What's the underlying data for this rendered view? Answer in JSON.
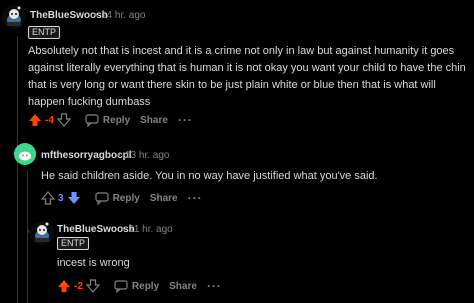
{
  "comments": [
    {
      "username": "TheBlueSwoosh",
      "time": "14 hr. ago",
      "flair": "ENTP",
      "text": "Absolutely not that is incest and it is a crime not only in law but against humanity it goes against literally everything that is human it is not okay you want your child to have the chin that is very long or want there skin to be just plain white or blue then that is what will happen fucking dumbass",
      "score": "-4",
      "vote_state": "upvoted",
      "reply_label": "Reply",
      "share_label": "Share",
      "more_label": "···"
    },
    {
      "username": "mfthesorryagbocpl",
      "time": "13 hr. ago",
      "text": "He said children aside. You in no way have justified what you've said.",
      "score": "3",
      "vote_state": "downvoted",
      "reply_label": "Reply",
      "share_label": "Share",
      "more_label": "···"
    },
    {
      "username": "TheBlueSwoosh",
      "time": "11 hr. ago",
      "flair": "ENTP",
      "text": "incest is wrong",
      "score": "-2",
      "vote_state": "upvoted",
      "reply_label": "Reply",
      "share_label": "Share",
      "more_label": "···"
    }
  ],
  "colors": {
    "upvote": "#ff4500",
    "downvote": "#7193ff",
    "muted": "#818384",
    "text": "#d7dadc"
  },
  "separator": "•"
}
